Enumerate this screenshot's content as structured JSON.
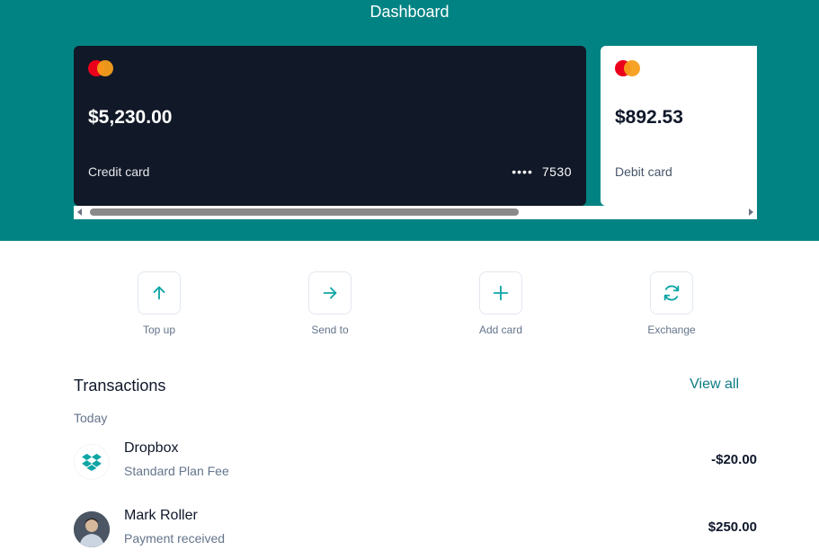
{
  "header": {
    "title": "Dashboard"
  },
  "cards": [
    {
      "amount": "$5,230.00",
      "label": "Credit card",
      "masked": "••••",
      "last4": "7530"
    },
    {
      "amount": "$892.53",
      "label": "Debit card"
    }
  ],
  "colors": {
    "header_bg": "#028383",
    "credit_card_bg": "#111827",
    "accent": "#0e7c86",
    "mastercard_red": "#eb001b",
    "mastercard_orange": "#f79e1b"
  },
  "actions": [
    {
      "label": "Top up",
      "icon": "arrow-up-icon"
    },
    {
      "label": "Send to",
      "icon": "arrow-right-icon"
    },
    {
      "label": "Add card",
      "icon": "plus-icon"
    },
    {
      "label": "Exchange",
      "icon": "refresh-icon"
    }
  ],
  "transactions": {
    "title": "Transactions",
    "view_all": "View all",
    "group": "Today",
    "items": [
      {
        "name": "Dropbox",
        "description": "Standard Plan Fee",
        "amount": "-$20.00",
        "icon": "dropbox-icon"
      },
      {
        "name": "Mark Roller",
        "description": "Payment received",
        "amount": "$250.00",
        "icon": "avatar"
      }
    ]
  }
}
